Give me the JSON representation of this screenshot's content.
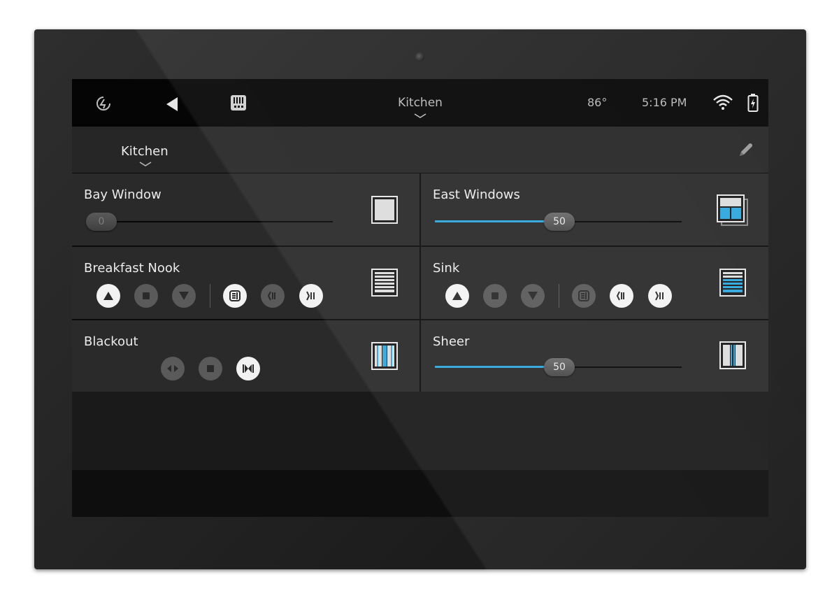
{
  "status_bar": {
    "room": "Kitchen",
    "temperature": "86°",
    "time": "5:16 PM"
  },
  "header": {
    "section": "Kitchen"
  },
  "tiles": {
    "bay_window": {
      "label": "Bay Window",
      "value": "0",
      "level": 0
    },
    "east_windows": {
      "label": "East Windows",
      "value": "50",
      "level": 0.5
    },
    "breakfast_nook": {
      "label": "Breakfast Nook"
    },
    "sink": {
      "label": "Sink"
    },
    "blackout": {
      "label": "Blackout"
    },
    "sheer": {
      "label": "Sheer",
      "value": "50",
      "level": 0.5
    }
  },
  "colors": {
    "accent": "#2fa6dc",
    "tile": "#2a2a2a",
    "status_bar": "#050505"
  },
  "icons": [
    "savant-logo-icon",
    "back-icon",
    "remote-icon",
    "chevron-down-icon",
    "wifi-icon",
    "battery-charging-icon",
    "pencil-icon",
    "shade-icon",
    "up-icon",
    "stop-icon",
    "down-icon",
    "scene-icon",
    "open-icon",
    "close-icon"
  ]
}
